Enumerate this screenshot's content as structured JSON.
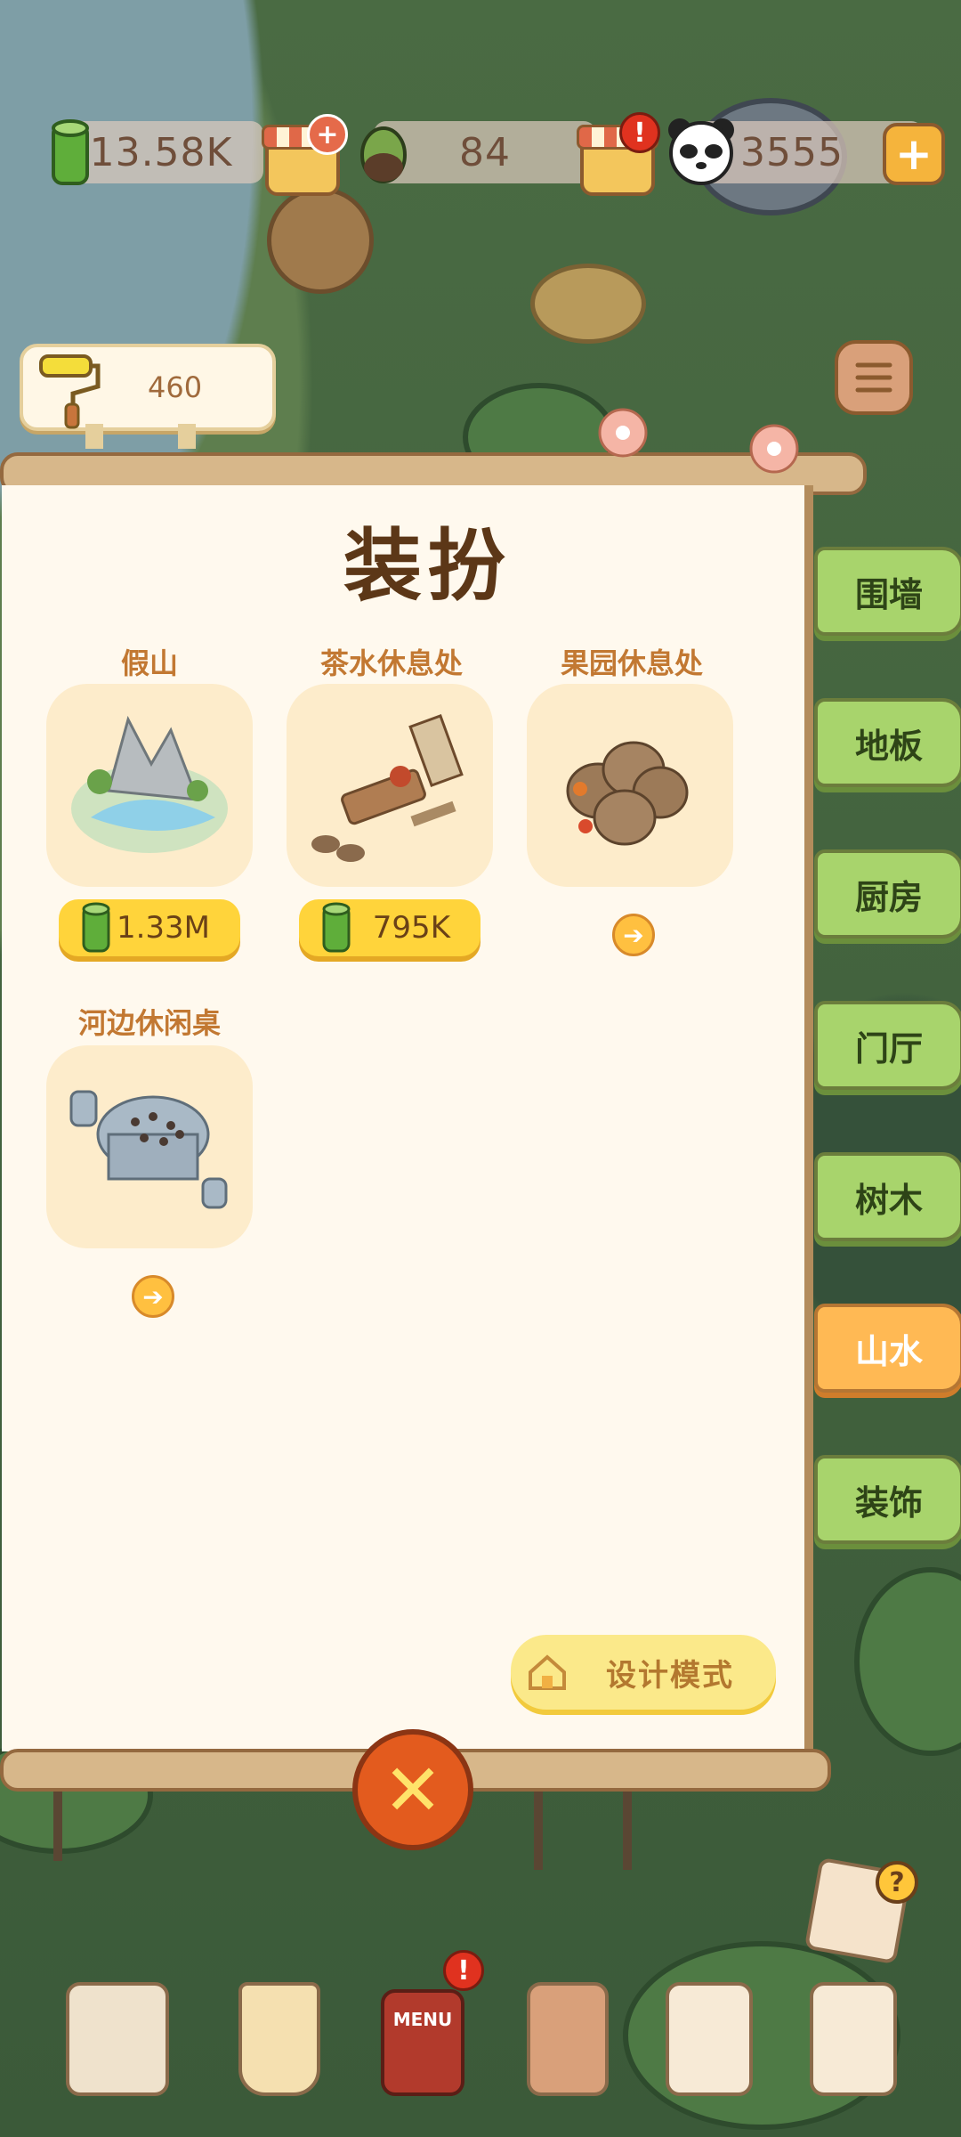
{
  "resources": {
    "bamboo": "13.58K",
    "leaves": "84",
    "panda_coins": "3555"
  },
  "paint": {
    "value": "460"
  },
  "panel": {
    "title": "装扮",
    "items": [
      {
        "name": "假山",
        "price": "1.33M",
        "has_price": true
      },
      {
        "name": "茶水休息处",
        "price": "795K",
        "has_price": true
      },
      {
        "name": "果园休息处",
        "price": "",
        "has_price": false
      },
      {
        "name": "河边休闲桌",
        "price": "",
        "has_price": false
      }
    ],
    "design_button": "设计模式"
  },
  "tabs": [
    {
      "label": "围墙",
      "active": false
    },
    {
      "label": "地板",
      "active": false
    },
    {
      "label": "厨房",
      "active": false
    },
    {
      "label": "门厅",
      "active": false
    },
    {
      "label": "树木",
      "active": false
    },
    {
      "label": "山水",
      "active": true
    },
    {
      "label": "装饰",
      "active": false
    }
  ],
  "colors": {
    "tab": "#a8d46c",
    "tab_active": "#ffb954",
    "price": "#ffd43b",
    "close": "#e35b1e"
  },
  "nav": {
    "menu_label": "MENU"
  }
}
